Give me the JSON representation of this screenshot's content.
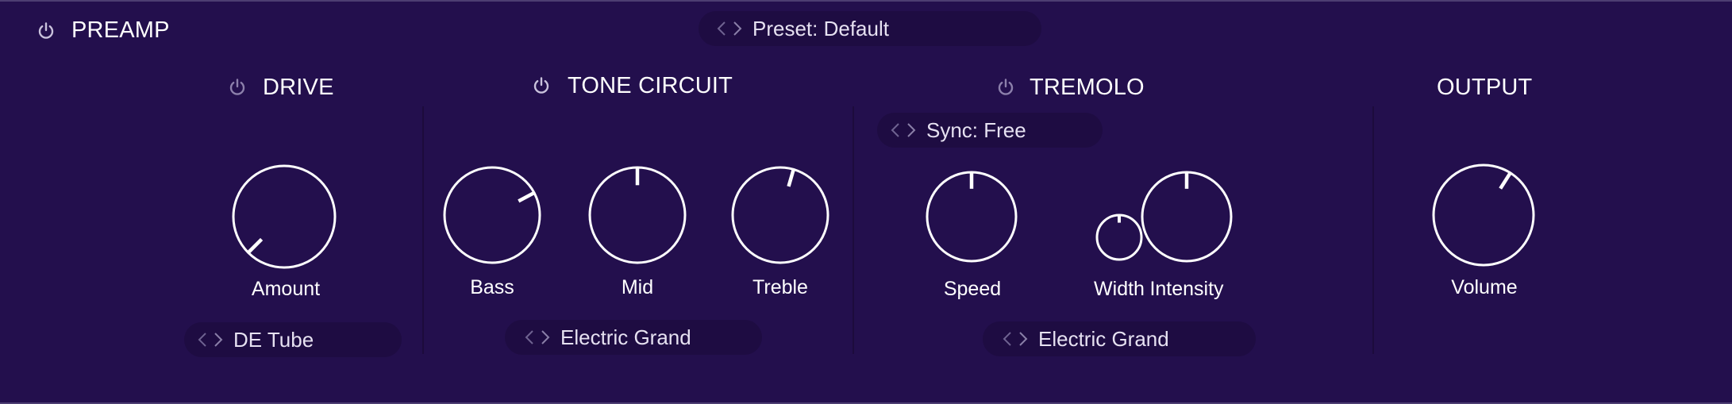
{
  "panel": {
    "title": "PREAMP",
    "preset": {
      "prefix": "Preset:",
      "value": "Default",
      "label": "Preset: Default"
    }
  },
  "sections": {
    "drive": {
      "title": "DRIVE",
      "knobs": [
        {
          "label": "Amount",
          "value": 0.0
        }
      ],
      "selector": "DE Tube"
    },
    "tone": {
      "title": "TONE CIRCUIT",
      "knobs": [
        {
          "label": "Bass",
          "value": 0.73
        },
        {
          "label": "Mid",
          "value": 0.5
        },
        {
          "label": "Treble",
          "value": 0.56
        }
      ],
      "selector": "Electric Grand"
    },
    "tremolo": {
      "title": "TREMOLO",
      "sync": "Sync: Free",
      "knobs": [
        {
          "label": "Speed",
          "value": 0.5
        },
        {
          "label": "Width",
          "value": 0.5
        },
        {
          "label": "Intensity",
          "value": 0.5
        }
      ],
      "selector": "Electric Grand"
    },
    "output": {
      "title": "OUTPUT",
      "knobs": [
        {
          "label": "Volume",
          "value": 0.62
        }
      ]
    }
  },
  "icons": {
    "power": "power-icon",
    "prev": "chevron-left-icon",
    "next": "chevron-right-icon"
  },
  "colors": {
    "background": "#230f4d",
    "pill": "#1e0c42",
    "text": "#ffffff",
    "icon_muted": "#a79dc1",
    "arrow_muted": "#6f6391"
  }
}
